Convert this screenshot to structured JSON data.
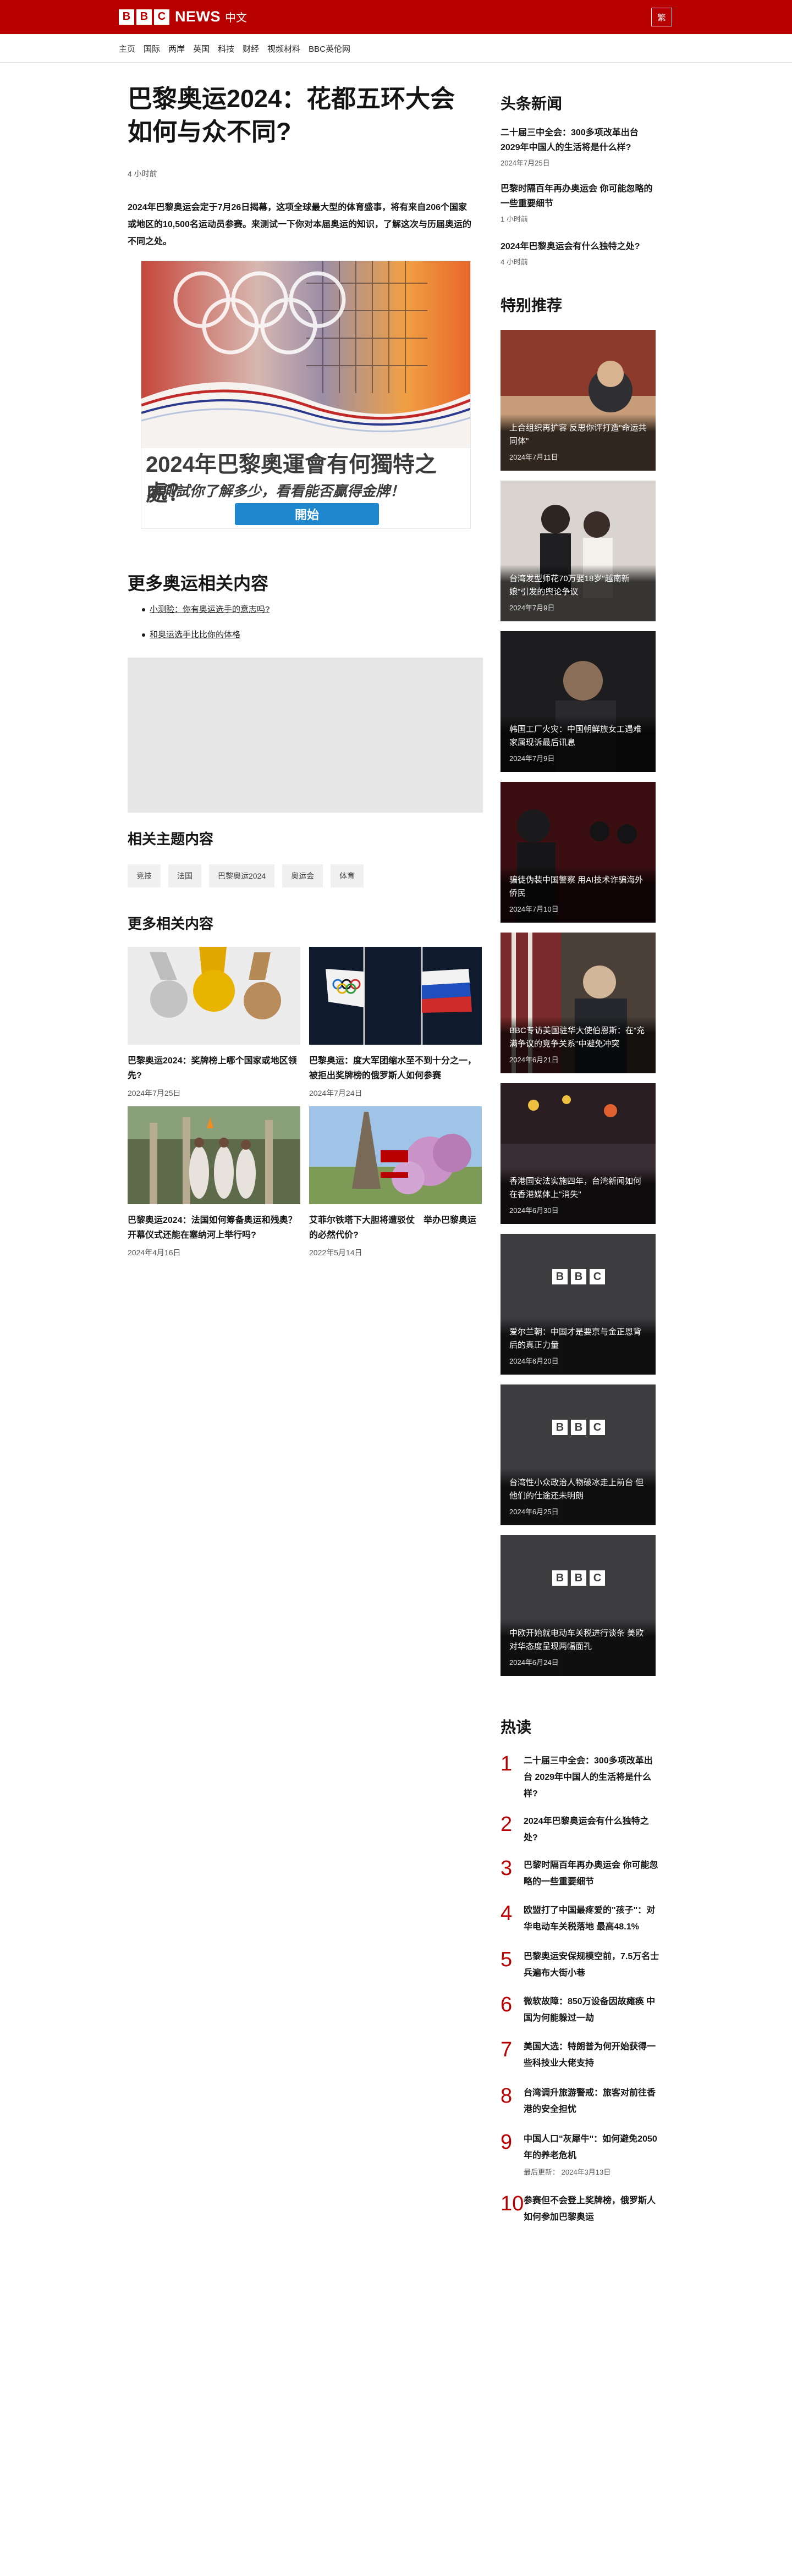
{
  "brand": {
    "bbc_letters": [
      "B",
      "B",
      "C"
    ],
    "news": "NEWS",
    "language": "中文",
    "lang_button": "繁",
    "accent": "#b80000"
  },
  "nav": [
    "主页",
    "国际",
    "两岸",
    "英国",
    "科技",
    "财经",
    "视频材料",
    "BBC英伦网"
  ],
  "article": {
    "headline": "巴黎奥运2024：花都五环大会如何与众不同?",
    "timestamp": "4 小时前",
    "lead": "2024年巴黎奥运会定于7月26日揭幕，这项全球最大型的体育盛事，将有来自206个国家或地区的10,500名运动员参赛。来测试一下你对本届奥运的知识，了解这次与历届奥运的不同之处。"
  },
  "promo": {
    "title": "2024年巴黎奧運會有何獨特之處？",
    "subtitle": "來測試你了解多少，看看能否贏得金牌！",
    "button": "開始"
  },
  "more_olympics": {
    "heading": "更多奥运相关内容",
    "links": [
      "小测验：你有奥运选手的意志吗?",
      "和奥运选手比比你的体格"
    ]
  },
  "related_topics": {
    "heading": "相关主题内容",
    "tags": [
      "竞技",
      "法国",
      "巴黎奥运2024",
      "奥运会",
      "体育"
    ]
  },
  "related_content": {
    "heading": "更多相关内容",
    "cards": [
      {
        "title": "巴黎奥运2024：奖牌榜上哪个国家或地区领先?",
        "date": "2024年7月25日"
      },
      {
        "title": "巴黎奥运：度大军团缩水至不到十分之一，被拒出奖牌榜的俄罗斯人如何参赛",
        "date": "2024年7月24日"
      },
      {
        "title": "巴黎奥运2024：法国如何筹备奥运和残奥？开幕仪式还能在塞纳河上举行吗?",
        "date": "2024年4月16日"
      },
      {
        "title": "艾菲尔铁塔下大胆将遭驳仗　举办巴黎奥运的必然代价?",
        "date": "2022年5月14日"
      }
    ]
  },
  "sidebar": {
    "top_news_heading": "头条新闻",
    "top_news": [
      {
        "title": "二十届三中全会：300多项改革出台 2029年中国人的生活将是什么样?",
        "date": "2024年7月25日"
      },
      {
        "title": "巴黎时隔百年再办奥运会 你可能忽略的一些重要细节",
        "date": "1 小时前"
      },
      {
        "title": "2024年巴黎奥运会有什么独特之处?",
        "date": "4 小时前"
      }
    ],
    "featured_heading": "特别推荐",
    "featured": [
      {
        "title": "上合组织再扩容 反思你评打造\"命运共同体\"",
        "date": "2024年7月11日"
      },
      {
        "title": "台湾发型师花70万娶18岁\"越南新娘\"引发的舆论争议",
        "date": "2024年7月9日"
      },
      {
        "title": "韩国工厂火灾：中国朝鲜族女工遇难 家属现诉最后讯息",
        "date": "2024年7月9日"
      },
      {
        "title": "骗徒伪装中国警察 用AI技术诈骗海外侨民",
        "date": "2024年7月10日"
      },
      {
        "title": "BBC专访美国驻华大使伯恩斯：在\"充满争议的竞争关系\"中避免冲突",
        "date": "2024年6月21日"
      },
      {
        "title": "香港国安法实施四年，台湾新闻如何在香港媒体上\"消失\"",
        "date": "2024年6月30日"
      },
      {
        "title": "爱尔兰朝：中国才是要京与金正恩背后的真正力量",
        "date": "2024年6月20日"
      },
      {
        "title": "台湾性小众政治人物破冰走上前台 但他们的仕途还未明朗",
        "date": "2024年6月25日"
      },
      {
        "title": "中欧开始就电动车关税进行谈条 美欧对华态度呈现两幅面孔",
        "date": "2024年6月24日"
      }
    ],
    "popular_heading": "热读",
    "popular": [
      {
        "num": "1",
        "title": "二十届三中全会：300多项改革出台 2029年中国人的生活将是什么样?"
      },
      {
        "num": "2",
        "title": "2024年巴黎奥运会有什么独特之处?"
      },
      {
        "num": "3",
        "title": "巴黎时隔百年再办奥运会 你可能忽略的一些重要细节"
      },
      {
        "num": "4",
        "title": "欧盟打了中国最疼爱的\"孩子\"：对华电动车关税落地 最高48.1%"
      },
      {
        "num": "5",
        "title": "巴黎奥运安保规模空前，7.5万名士兵遍布大街小巷"
      },
      {
        "num": "6",
        "title": "微软故障：850万设备因故瘫痪 中国为何能躲过一劫"
      },
      {
        "num": "7",
        "title": "美国大选：特朗普为何开始获得一些科技业大佬支持"
      },
      {
        "num": "8",
        "title": "台湾调升旅游警戒：旅客对前往香港的安全担忧"
      },
      {
        "num": "9",
        "title": "中国人口\"灰犀牛\"：如何避免2050年的养老危机",
        "date_label": "最后更新：",
        "date": "2024年3月13日"
      },
      {
        "num": "10",
        "title": "参赛但不会登上奖牌榜，俄罗斯人如何参加巴黎奥运"
      }
    ]
  }
}
